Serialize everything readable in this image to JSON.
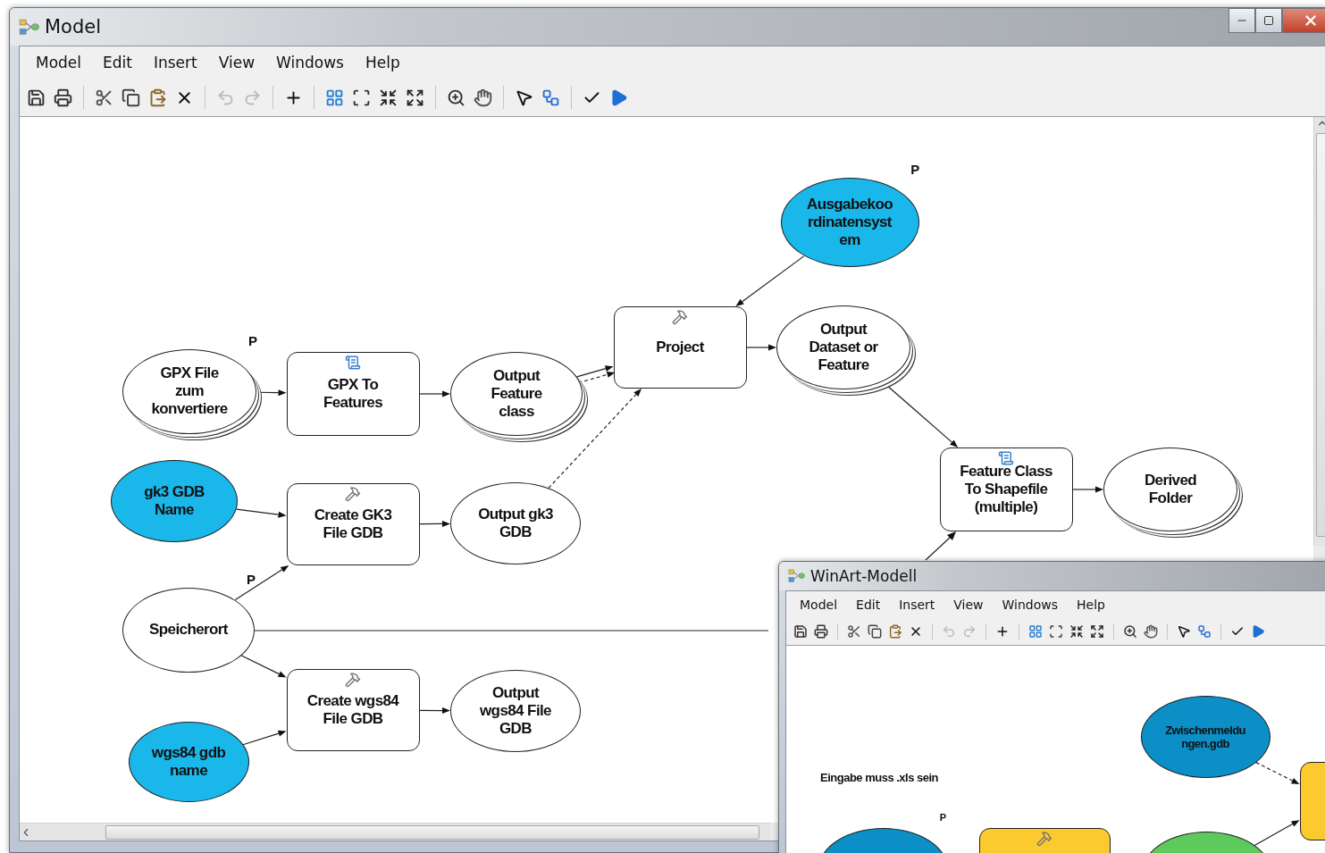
{
  "main_window": {
    "title": "Model",
    "menu": [
      "Model",
      "Edit",
      "Insert",
      "View",
      "Windows",
      "Help"
    ],
    "diagram": {
      "nodes": [
        {
          "kind": "variable",
          "label": "Ausgabekoordinatensystem",
          "parameter_label": "P",
          "multiple": false
        },
        {
          "kind": "data",
          "label": "GPX File zum konvertiere",
          "parameter_label": "P",
          "multiple": true
        },
        {
          "kind": "script_tool",
          "label": "GPX To Features"
        },
        {
          "kind": "data",
          "label": "Output Feature class",
          "multiple": true
        },
        {
          "kind": "tool",
          "label": "Project"
        },
        {
          "kind": "data",
          "label": "Output Dataset or Feature",
          "multiple": true
        },
        {
          "kind": "variable",
          "label": "gk3 GDB Name",
          "multiple": false
        },
        {
          "kind": "tool",
          "label": "Create GK3 File GDB"
        },
        {
          "kind": "data",
          "label": "Output gk3 GDB",
          "multiple": false
        },
        {
          "kind": "script_tool",
          "label": "Feature Class To Shapefile (multiple)"
        },
        {
          "kind": "data",
          "label": "Derived Folder",
          "multiple": true
        },
        {
          "kind": "data",
          "label": "Speicherort",
          "parameter_label": "P",
          "multiple": false
        },
        {
          "kind": "tool",
          "label": "Create wgs84 File GDB"
        },
        {
          "kind": "data",
          "label": "Output wgs84 File GDB",
          "multiple": false
        },
        {
          "kind": "variable",
          "label": "wgs84 gdb name",
          "multiple": false
        }
      ],
      "labels": []
    }
  },
  "second_window": {
    "title": "WinArt-Modell",
    "menu": [
      "Model",
      "Edit",
      "Insert",
      "View",
      "Windows",
      "Help"
    ],
    "diagram": {
      "nodes": [
        {
          "kind": "variable",
          "label": "Zwischenmeldungen.gdb",
          "multiple": false
        },
        {
          "kind": "variable",
          "parameter_label": "P"
        },
        {
          "kind": "tool"
        },
        {
          "kind": "data"
        },
        {
          "kind": "tool"
        }
      ],
      "labels": [
        "Eingabe muss .xls sein"
      ]
    }
  }
}
